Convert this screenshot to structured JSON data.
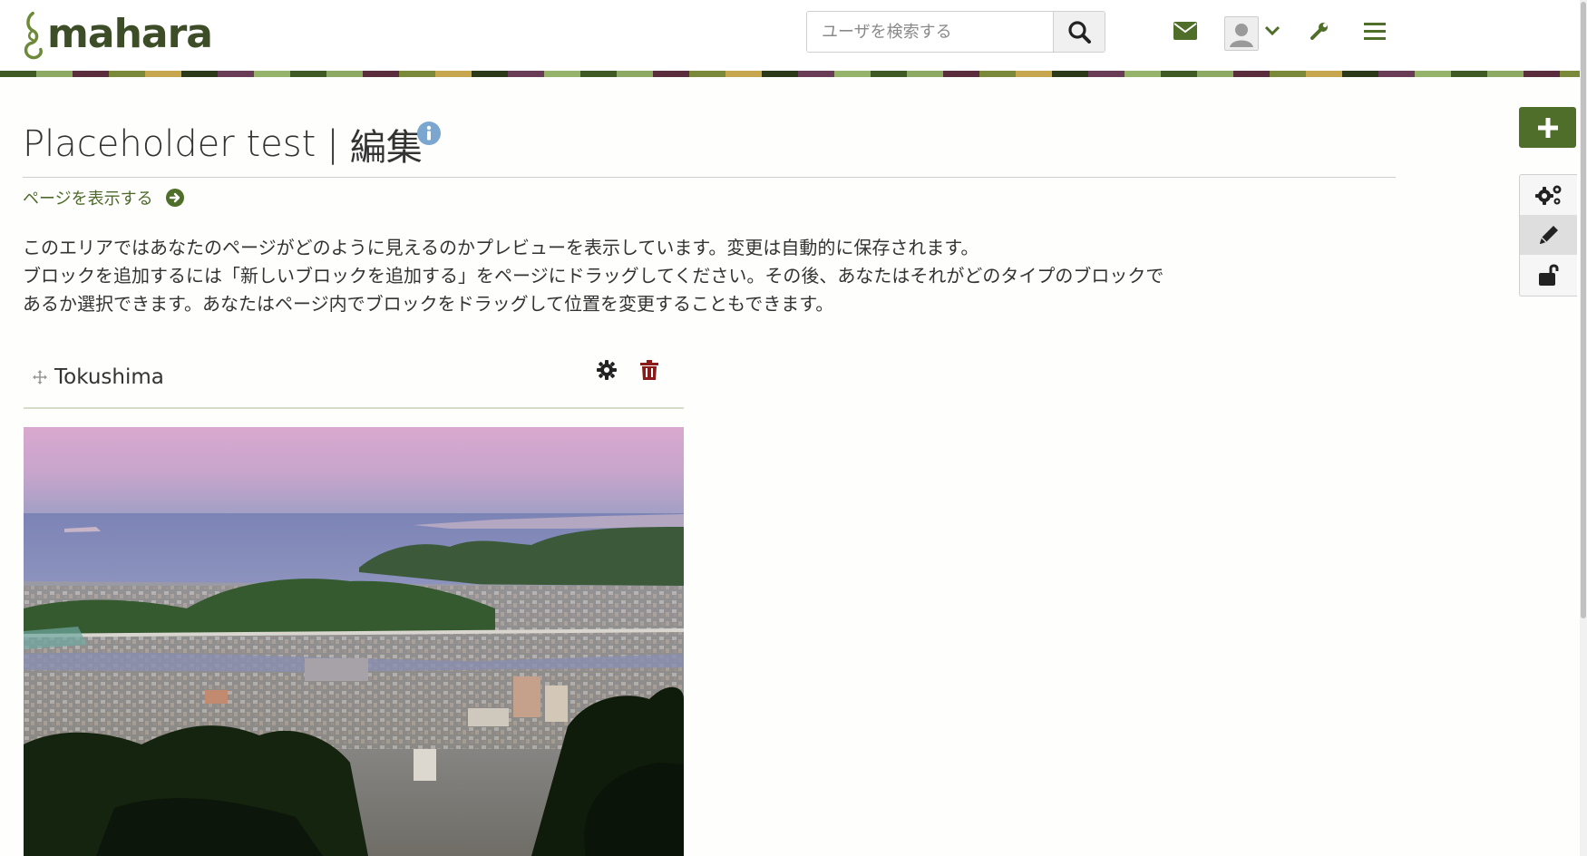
{
  "header": {
    "logo_text": "mahara",
    "search": {
      "placeholder": "ユーザを検索する",
      "value": ""
    },
    "icons": [
      "envelope-icon",
      "user-avatar",
      "chevron-down-icon",
      "wrench-icon",
      "hamburger-menu-icon"
    ]
  },
  "page": {
    "title_main": "Placeholder test",
    "title_separator": "|",
    "title_mode": "編集",
    "view_page_link": "ページを表示する",
    "description_lines": [
      "このエリアではあなたのページがどのように見えるのかプレビューを表示しています。変更は自動的に保存されます。",
      "ブロックを追加するには「新しいブロックを追加する」をページにドラッグしてください。その後、あなたはそれがどのタイプのブロックで",
      "あるか選択できます。あなたはページ内でブロックをドラッグして位置を変更することもできます。"
    ]
  },
  "block": {
    "title": "Tokushima",
    "image_alt": "Tokushima city panorama"
  },
  "toolbar": {
    "buttons": [
      "add-block",
      "settings",
      "edit",
      "share"
    ],
    "active": "edit"
  },
  "colors": {
    "brand_green": "#4f6e2a",
    "link_green": "#4d6a2a",
    "delete_red": "#8b1a1a",
    "info_blue": "#7aa6cf"
  }
}
